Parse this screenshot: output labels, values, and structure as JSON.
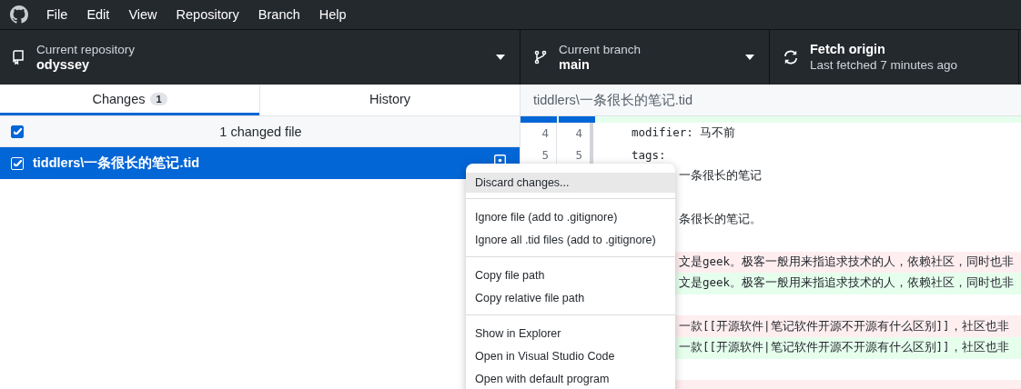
{
  "menu_bar": [
    "File",
    "Edit",
    "View",
    "Repository",
    "Branch",
    "Help"
  ],
  "toolbar": {
    "repository": {
      "label": "Current repository",
      "value": "odyssey"
    },
    "branch": {
      "label": "Current branch",
      "value": "main"
    },
    "fetch": {
      "title": "Fetch origin",
      "subtitle": "Last fetched 7 minutes ago"
    }
  },
  "tabs": [
    {
      "label": "Changes",
      "count": "1",
      "selected": true
    },
    {
      "label": "History",
      "selected": false
    }
  ],
  "changes_header": {
    "text": "1 changed file",
    "checked": true
  },
  "files": [
    {
      "path": "tiddlers\\一条很长的笔记.tid",
      "checked": true,
      "selected": true
    }
  ],
  "diff": {
    "file": "tiddlers\\一条很长的笔记.tid",
    "lines": [
      {
        "kind": "context",
        "old": "4",
        "new": "4",
        "text": "modifier: 马不前"
      },
      {
        "kind": "context",
        "old": "5",
        "new": "5",
        "text": "tags:"
      },
      {
        "kind": "context",
        "text": "一条很长的笔记"
      },
      {
        "kind": "context"
      },
      {
        "kind": "context",
        "text": "条很长的笔记。"
      },
      {
        "kind": "context"
      },
      {
        "kind": "removed",
        "text": "文是geek。极客一般用来指追求技术的人，依赖社区，同时也非"
      },
      {
        "kind": "added",
        "text": "文是geek。极客一般用来指追求技术的人，依赖社区，同时也非"
      },
      {
        "kind": "context"
      },
      {
        "kind": "removed",
        "text": "一款[[开源软件|笔记软件开源不开源有什么区别]]，社区也非"
      },
      {
        "kind": "added",
        "text": "一款[[开源软件|笔记软件开源不开源有什么区别]]，社区也非"
      },
      {
        "kind": "context"
      },
      {
        "kind": "removed"
      }
    ]
  },
  "context_menu": {
    "groups": [
      [
        {
          "label": "Discard changes...",
          "selected": true
        }
      ],
      [
        {
          "label": "Ignore file (add to .gitignore)",
          "selected": false
        },
        {
          "label": "Ignore all .tid files (add to .gitignore)",
          "selected": false
        }
      ],
      [
        {
          "label": "Copy file path",
          "selected": false
        },
        {
          "label": "Copy relative file path",
          "selected": false
        }
      ],
      [
        {
          "label": "Show in Explorer",
          "selected": false
        },
        {
          "label": "Open in Visual Studio Code",
          "selected": false
        },
        {
          "label": "Open with default program",
          "selected": false
        }
      ]
    ]
  }
}
